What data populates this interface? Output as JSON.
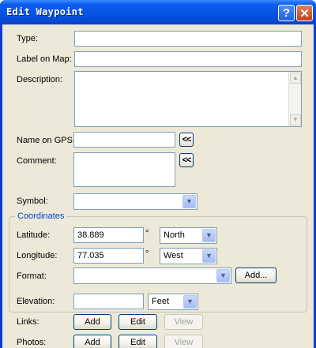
{
  "window": {
    "title": "Edit Waypoint",
    "help_label": "?",
    "close_label": "✕"
  },
  "fields": {
    "type": {
      "label": "Type:",
      "value": ""
    },
    "label_on_map": {
      "label": "Label on Map:",
      "value": ""
    },
    "description": {
      "label": "Description:",
      "value": ""
    },
    "name_on_gps": {
      "label": "Name on GPS:",
      "value": "",
      "button": "<<"
    },
    "comment": {
      "label": "Comment:",
      "value": "",
      "button": "<<"
    },
    "symbol": {
      "label": "Symbol:",
      "value": ""
    }
  },
  "coordinates": {
    "group_label": "Coordinates",
    "latitude": {
      "label": "Latitude:",
      "value": "38.889",
      "unit": "°",
      "hemisphere": "North"
    },
    "longitude": {
      "label": "Longitude:",
      "value": "77.035",
      "unit": "°",
      "hemisphere": "West"
    },
    "format": {
      "label": "Format:",
      "value": "",
      "button": "Add..."
    }
  },
  "elevation": {
    "label": "Elevation:",
    "value": "",
    "unit": "Feet"
  },
  "links": {
    "label": "Links:",
    "add": "Add",
    "edit": "Edit",
    "view": "View"
  },
  "photos": {
    "label": "Photos:",
    "add": "Add",
    "edit": "Edit",
    "view": "View"
  },
  "icons": {
    "dropdown": "chevron-down-icon",
    "scroll_up": "scroll-up-icon",
    "scroll_down": "scroll-down-icon"
  }
}
